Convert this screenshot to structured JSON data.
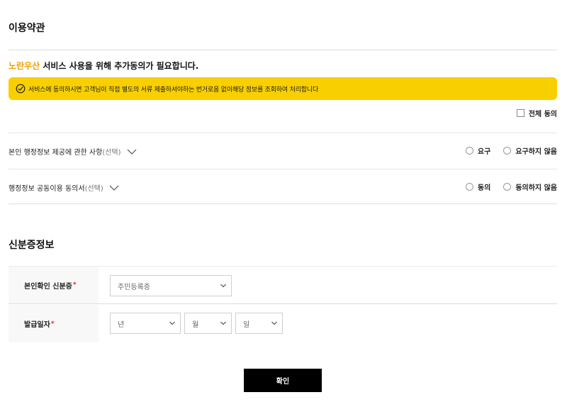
{
  "terms": {
    "title": "이용약관",
    "notice_brand": "노란우산",
    "notice_text": " 서비스 사용을 위해 추가동의가 필요합니다.",
    "banner_text": "서비스에 동의하시면 고객님이 직접 별도의 서류 제출하셔야하는 번거로움 없이해당 정보를 조회하여 처리합니다",
    "all_agree_label": "전체 동의",
    "items": [
      {
        "title": "본인 행정정보 제공에 관한 사항",
        "sub": "(선택)",
        "option_a": "요구",
        "option_b": "요구하지 않음"
      },
      {
        "title": "행정정보 공동이용 동의서",
        "sub": "(선택)",
        "option_a": "동의",
        "option_b": "동의하지 않음"
      }
    ]
  },
  "id_info": {
    "title": "신분증정보",
    "id_type_label": "본인확인 신분증",
    "id_type_value": "주민등록증",
    "issue_date_label": "발급일자",
    "year_placeholder": "년",
    "month_placeholder": "월",
    "day_placeholder": "일",
    "required_mark": "*"
  },
  "confirm_label": "확인",
  "colors": {
    "banner_yellow": "#f8cf00",
    "brand_orange": "#f0a000",
    "required_red": "#e02020",
    "button_black": "#000000"
  }
}
